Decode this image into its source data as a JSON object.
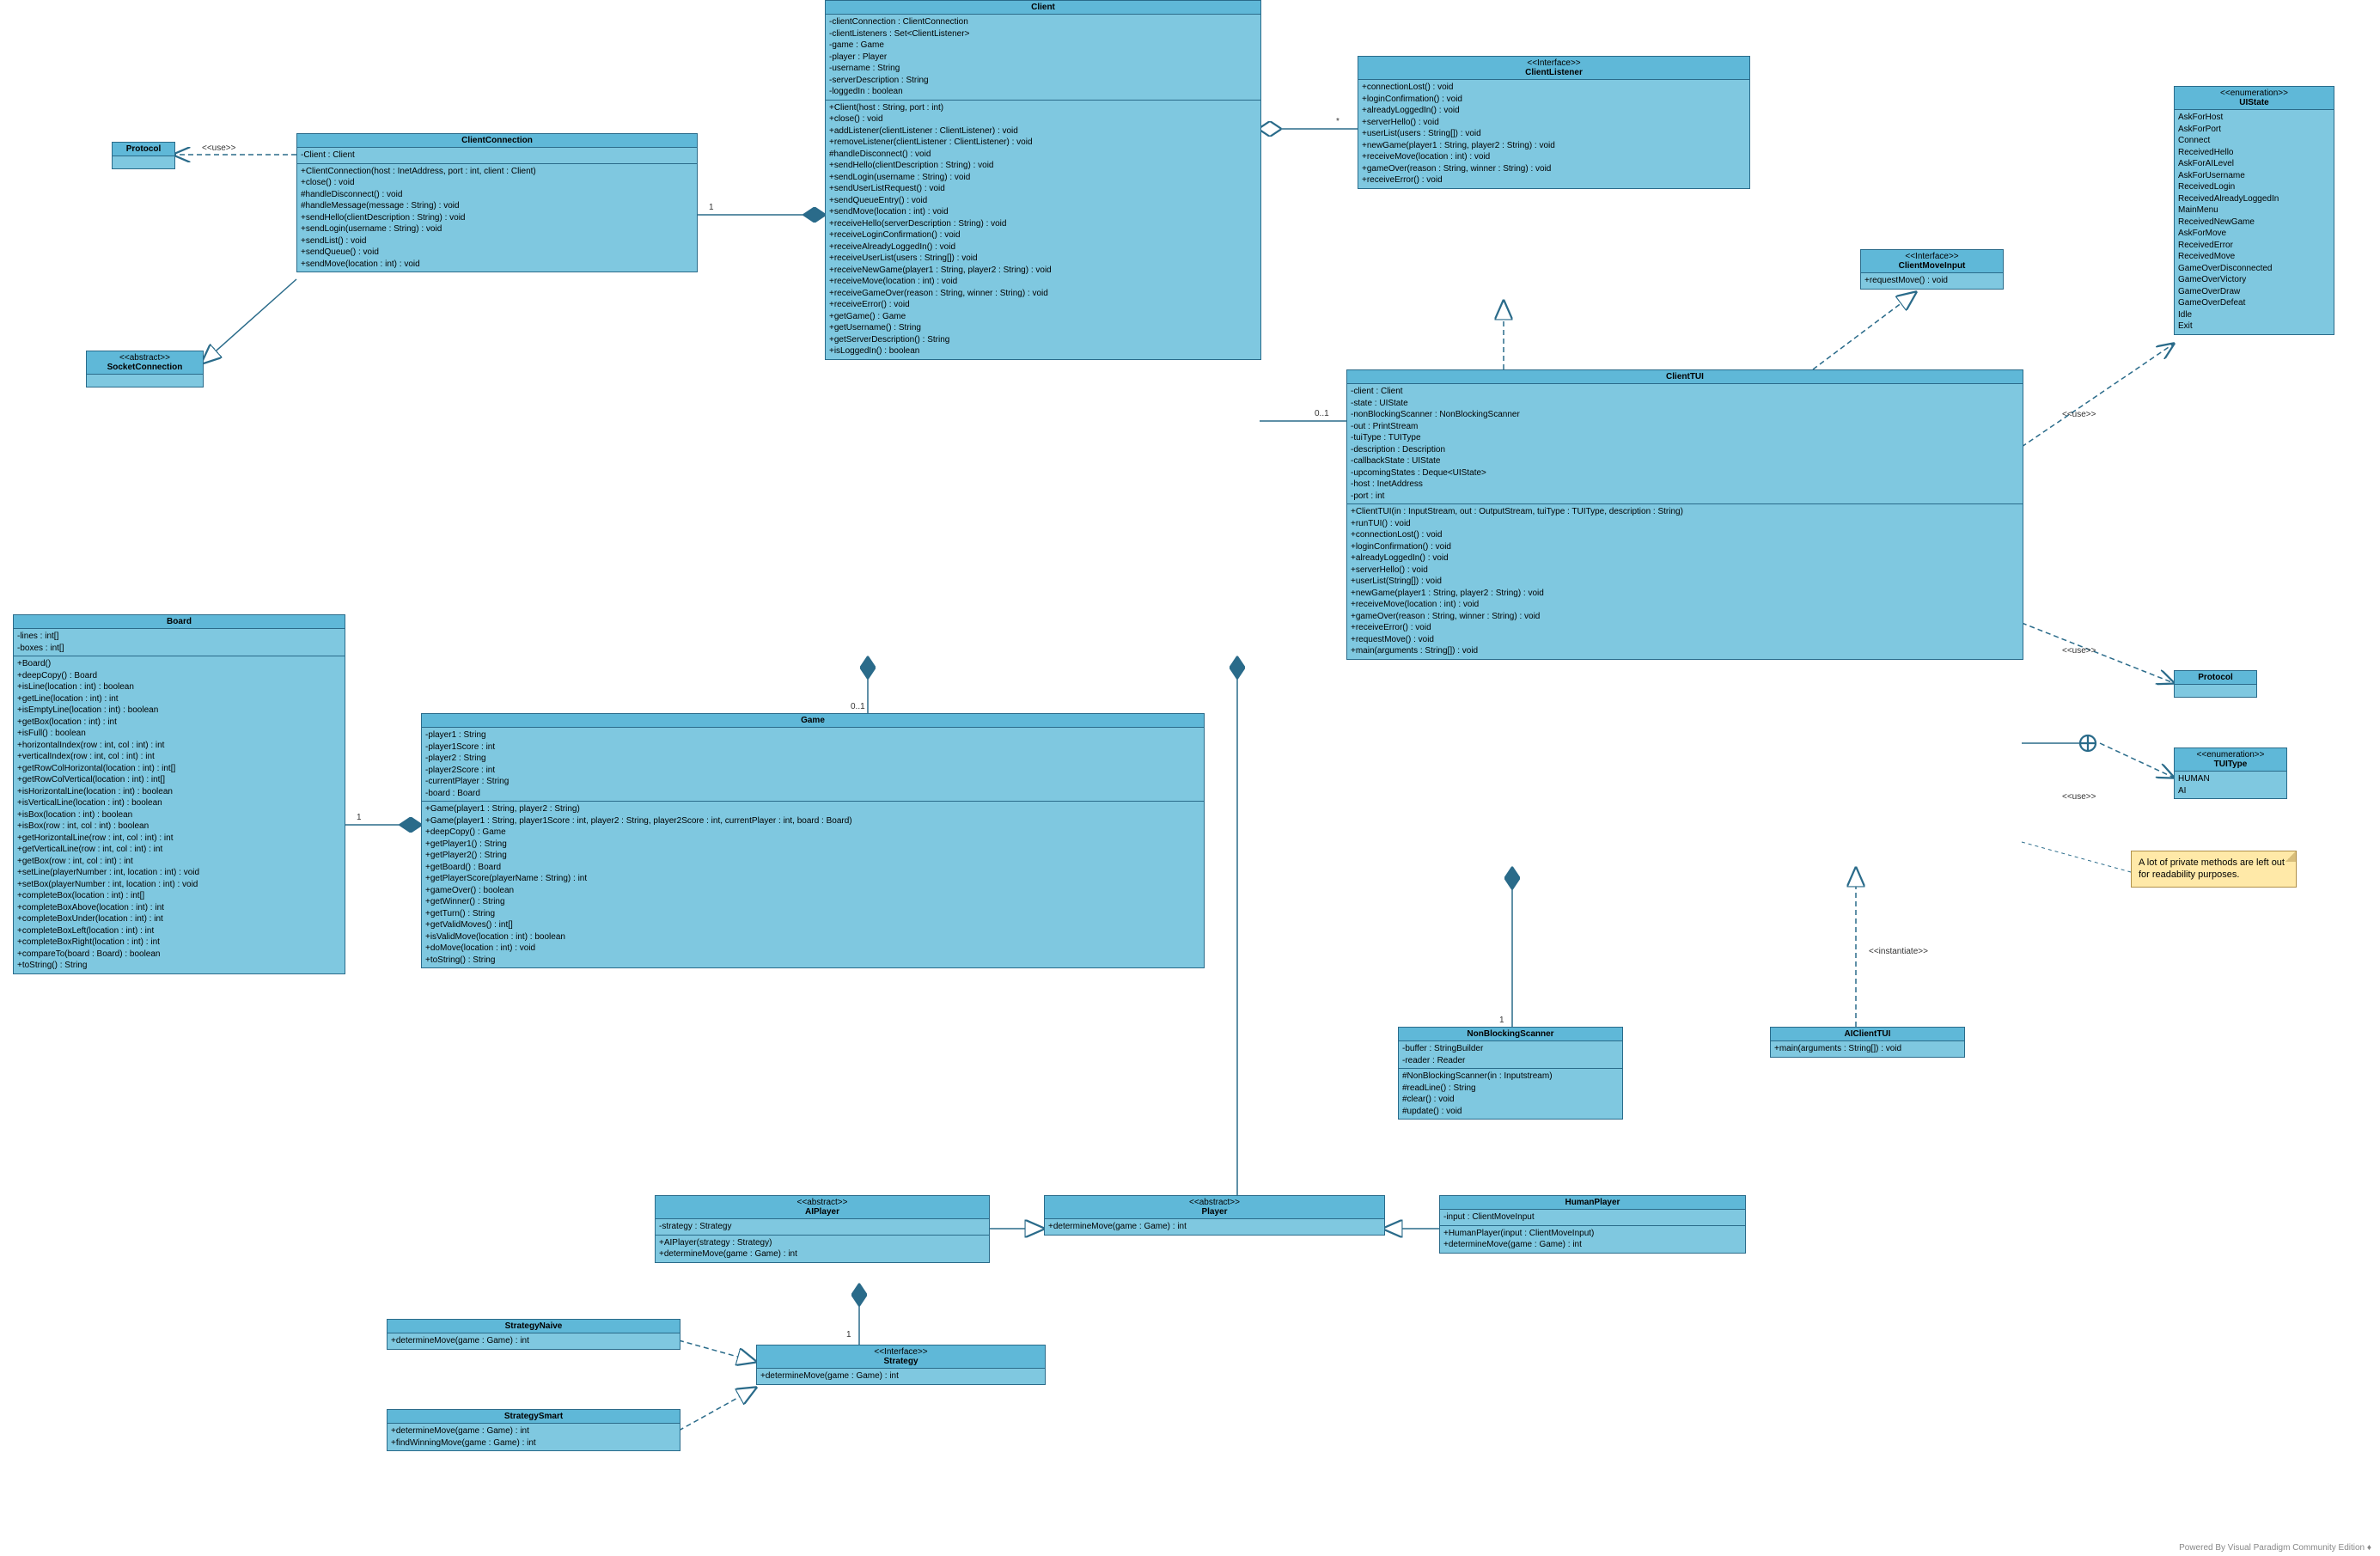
{
  "footer": "Powered By  Visual Paradigm Community Edition ♦",
  "note": "A lot of private methods are left out for readability purposes.",
  "classes": {
    "Protocol1": {
      "title": "Protocol",
      "stereo": ""
    },
    "SocketConnection": {
      "title": "SocketConnection",
      "stereo": "<<abstract>>"
    },
    "ClientConnection": {
      "title": "ClientConnection",
      "attrs": [
        "-Client : Client"
      ],
      "ops": [
        "+ClientConnection(host : InetAddress, port : int, client : Client)",
        "+close() : void",
        "#handleDisconnect() : void",
        "#handleMessage(message : String) : void",
        "+sendHello(clientDescription : String) : void",
        "+sendLogin(username : String) : void",
        "+sendList() : void",
        "+sendQueue() : void",
        "+sendMove(location : int) : void"
      ]
    },
    "Client": {
      "title": "Client",
      "attrs": [
        "-clientConnection : ClientConnection",
        "-clientListeners : Set<ClientListener>",
        "-game : Game",
        "-player : Player",
        "-username : String",
        "-serverDescription : String",
        "-loggedIn : boolean"
      ],
      "ops": [
        "+Client(host : String, port : int)",
        "+close() : void",
        "+addListener(clientListener : ClientListener) : void",
        "+removeListener(clientListener : ClientListener) : void",
        "#handleDisconnect() : void",
        "+sendHello(clientDescription : String) : void",
        "+sendLogin(username : String) : void",
        "+sendUserListRequest() : void",
        "+sendQueueEntry() : void",
        "+sendMove(location : int) : void",
        "+receiveHello(serverDescription : String) : void",
        "+receiveLoginConfirmation() : void",
        "+receiveAlreadyLoggedIn() : void",
        "+receiveUserList(users : String[]) : void",
        "+receiveNewGame(player1 : String, player2 : String) : void",
        "+receiveMove(location : int) : void",
        "+receiveGameOver(reason : String, winner : String) : void",
        "+receiveError() : void",
        "+getGame() : Game",
        "+getUsername() : String",
        "+getServerDescription() : String",
        "+isLoggedIn() : boolean"
      ]
    },
    "ClientListener": {
      "title": "ClientListener",
      "stereo": "<<Interface>>",
      "ops": [
        "+connectionLost() : void",
        "+loginConfirmation() : void",
        "+alreadyLoggedIn() : void",
        "+serverHello() : void",
        "+userList(users : String[]) : void",
        "+newGame(player1 : String, player2 : String) : void",
        "+receiveMove(location : int) : void",
        "+gameOver(reason : String, winner : String) : void",
        "+receiveError() : void"
      ]
    },
    "ClientMoveInput": {
      "title": "ClientMoveInput",
      "stereo": "<<Interface>>",
      "ops": [
        "+requestMove() : void"
      ]
    },
    "UIState": {
      "title": "UIState",
      "stereo": "<<enumeration>>",
      "ops": [
        "AskForHost",
        "AskForPort",
        "Connect",
        "ReceivedHello",
        "AskForAILevel",
        "AskForUsername",
        "ReceivedLogin",
        "ReceivedAlreadyLoggedIn",
        "MainMenu",
        "ReceivedNewGame",
        "AskForMove",
        "ReceivedError",
        "ReceivedMove",
        "GameOverDisconnected",
        "GameOverVictory",
        "GameOverDraw",
        "GameOverDefeat",
        "Idle",
        "Exit"
      ]
    },
    "Protocol2": {
      "title": "Protocol"
    },
    "TUIType": {
      "title": "TUIType",
      "stereo": "<<enumeration>>",
      "ops": [
        "HUMAN",
        "AI"
      ]
    },
    "ClientTUI": {
      "title": "ClientTUI",
      "attrs": [
        "-client : Client",
        "-state : UIState",
        "-nonBlockingScanner : NonBlockingScanner",
        "-out : PrintStream",
        "-tuiType : TUIType",
        "-description : Description",
        "-callbackState : UIState",
        "-upcomingStates : Deque<UIState>",
        "-host : InetAddress",
        "-port : int"
      ],
      "ops": [
        "+ClientTUI(in : InputStream, out : OutputStream, tuiType : TUIType, description : String)",
        "+runTUI() : void",
        "+connectionLost() : void",
        "+loginConfirmation() : void",
        "+alreadyLoggedIn() : void",
        "+serverHello() : void",
        "+userList(String[]) : void",
        "+newGame(player1 : String, player2 : String) : void",
        "+receiveMove(location : int) : void",
        "+gameOver(reason : String, winner : String) : void",
        "+receiveError() : void",
        "+requestMove() : void",
        "+main(arguments : String[]) : void"
      ]
    },
    "NonBlockingScanner": {
      "title": "NonBlockingScanner",
      "attrs": [
        "-buffer : StringBuilder",
        "-reader : Reader"
      ],
      "ops": [
        "#NonBlockingScanner(in : Inputstream)",
        "#readLine() : String",
        "#clear() : void",
        "#update() : void"
      ]
    },
    "AIClientTUI": {
      "title": "AIClientTUI",
      "ops": [
        "+main(arguments : String[]) : void"
      ]
    },
    "Board": {
      "title": "Board",
      "attrs": [
        "-lines : int[]",
        "-boxes : int[]"
      ],
      "ops": [
        "+Board()",
        "+deepCopy() : Board",
        "+isLine(location : int) : boolean",
        "+getLine(location : int) : int",
        "+isEmptyLine(location : int) : boolean",
        "+getBox(location : int) : int",
        "+isFull() : boolean",
        "+horizontalIndex(row : int, col : int) : int",
        "+verticalIndex(row : int, col : int) : int",
        "+getRowColHorizontal(location : int) : int[]",
        "+getRowColVertical(location : int) : int[]",
        "+isHorizontalLine(location : int) : boolean",
        "+isVerticalLine(location : int) : boolean",
        "+isBox(location : int) : boolean",
        "+isBox(row : int, col : int) : boolean",
        "+getHorizontalLine(row : int, col : int) : int",
        "+getVerticalLine(row : int, col : int) : int",
        "+getBox(row : int, col : int) : int",
        "+setLine(playerNumber : int, location : int) : void",
        "+setBox(playerNumber : int, location : int) : void",
        "+completeBox(location : int) : int[]",
        "+completeBoxAbove(location : int) : int",
        "+completeBoxUnder(location : int) : int",
        "+completeBoxLeft(location : int) : int",
        "+completeBoxRight(location : int) : int",
        "+compareTo(board : Board) : boolean",
        "+toString() : String"
      ]
    },
    "Game": {
      "title": "Game",
      "attrs": [
        "-player1 : String",
        "-player1Score : int",
        "-player2 : String",
        "-player2Score : int",
        "-currentPlayer : String",
        "-board : Board"
      ],
      "ops": [
        "+Game(player1 : String, player2 : String)",
        "+Game(player1 : String, player1Score : int, player2 : String, player2Score : int, currentPlayer : int, board : Board)",
        "+deepCopy() : Game",
        "+getPlayer1() : String",
        "+getPlayer2() : String",
        "+getBoard() : Board",
        "+getPlayerScore(playerName : String) : int",
        "+gameOver() : boolean",
        "+getWinner() : String",
        "+getTurn() : String",
        "+getValidMoves() : int[]",
        "+isValidMove(location : int) : boolean",
        "+doMove(location : int) : void",
        "+toString() : String"
      ]
    },
    "AIPlayer": {
      "title": "AIPlayer",
      "stereo": "<<abstract>>",
      "attrs": [
        "-strategy : Strategy"
      ],
      "ops": [
        "+AIPlayer(strategy : Strategy)",
        "+determineMove(game : Game) : int"
      ]
    },
    "Player": {
      "title": "Player",
      "stereo": "<<abstract>>",
      "ops": [
        "+determineMove(game : Game) : int"
      ]
    },
    "HumanPlayer": {
      "title": "HumanPlayer",
      "attrs": [
        "-input : ClientMoveInput"
      ],
      "ops": [
        "+HumanPlayer(input : ClientMoveInput)",
        "+determineMove(game : Game) : int"
      ]
    },
    "Strategy": {
      "title": "Strategy",
      "stereo": "<<Interface>>",
      "ops": [
        "+determineMove(game : Game) : int"
      ]
    },
    "StrategyNaive": {
      "title": "StrategyNaive",
      "ops": [
        "+determineMove(game : Game) : int"
      ]
    },
    "StrategySmart": {
      "title": "StrategySmart",
      "ops": [
        "+determineMove(game : Game) : int",
        "+findWinningMove(game : Game) : int"
      ]
    }
  },
  "labels": {
    "use": "<<use>>",
    "instantiate": "<<instantiate>>",
    "one": "1",
    "star": "*",
    "zeroOne": "0..1"
  }
}
